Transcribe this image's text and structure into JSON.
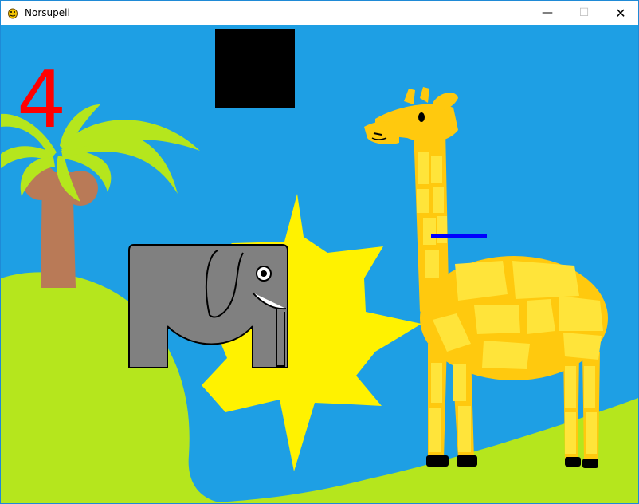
{
  "window": {
    "title": "Norsupeli",
    "controls": {
      "minimize": "—",
      "maximize": "☐",
      "close": "✕"
    }
  },
  "game": {
    "score": "4",
    "colors": {
      "sky": "#1e9fe4",
      "grass": "#b5e61d",
      "sun": "#fff200",
      "score": "#ff0000",
      "elephant": "#808080",
      "giraffe": "#ffc90e",
      "giraffe_light": "#ffe43a",
      "trunk": "#b97a57",
      "bar": "#0000ff",
      "box": "#000000"
    },
    "icons": {
      "app": "pygame-snake-icon",
      "minimize": "minimize-icon",
      "maximize": "maximize-icon",
      "close": "close-icon"
    }
  }
}
